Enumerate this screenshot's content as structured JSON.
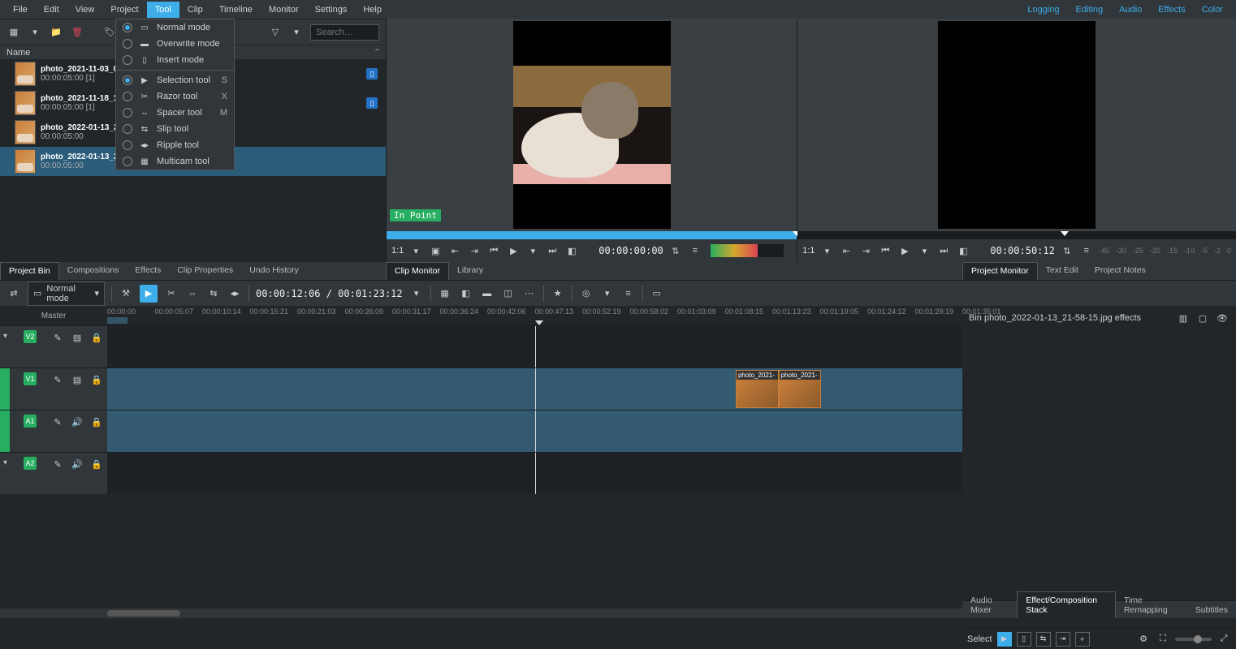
{
  "menubar": {
    "left": [
      "File",
      "Edit",
      "View",
      "Project",
      "Tool",
      "Clip",
      "Timeline",
      "Monitor",
      "Settings",
      "Help"
    ],
    "right": [
      "Logging",
      "Editing",
      "Audio",
      "Effects",
      "Color"
    ],
    "active_index": 4
  },
  "tool_menu": {
    "modes": [
      {
        "label": "Normal mode",
        "checked": true,
        "icon": "▭"
      },
      {
        "label": "Overwrite mode",
        "checked": false,
        "icon": "▬"
      },
      {
        "label": "Insert mode",
        "checked": false,
        "icon": "▯"
      }
    ],
    "tools": [
      {
        "label": "Selection tool",
        "shortcut": "S",
        "checked": true,
        "icon": "▶"
      },
      {
        "label": "Razor tool",
        "shortcut": "X",
        "checked": false,
        "icon": "✂"
      },
      {
        "label": "Spacer tool",
        "shortcut": "M",
        "checked": false,
        "icon": "⇔"
      },
      {
        "label": "Slip tool",
        "shortcut": "",
        "checked": false,
        "icon": "⇆"
      },
      {
        "label": "Ripple tool",
        "shortcut": "",
        "checked": false,
        "icon": "◂▸"
      },
      {
        "label": "Multicam tool",
        "shortcut": "",
        "checked": false,
        "icon": "▦"
      }
    ]
  },
  "bin_toolbar": {
    "search_placeholder": "Search…"
  },
  "bin_header": {
    "name_col": "Name"
  },
  "bin": [
    {
      "name": "photo_2021-11-03_0…",
      "sub": "00:00:05:00 [1]",
      "selected": false,
      "badges": true
    },
    {
      "name": "photo_2021-11-18_1…",
      "sub": "00:00:05:00 [1]",
      "selected": false,
      "badges": true
    },
    {
      "name": "photo_2022-01-13_2…",
      "sub": "00:00:05:00",
      "selected": false,
      "badges": false
    },
    {
      "name": "photo_2022-01-13_2…",
      "sub": "00:00:05:00",
      "selected": true,
      "badges": false
    }
  ],
  "panel_tabs_left": [
    "Project Bin",
    "Compositions",
    "Effects",
    "Clip Properties",
    "Undo History"
  ],
  "clip_monitor": {
    "tabs": [
      "Clip Monitor",
      "Library"
    ],
    "in_point_label": "In Point",
    "zoom": "1:1",
    "timecode": "00:00:00:00",
    "zone_pct": 100,
    "playhead_pct": 100
  },
  "project_monitor": {
    "tabs": [
      "Project Monitor",
      "Text Edit",
      "Project Notes"
    ],
    "zoom": "1:1",
    "timecode": "00:00:50:12",
    "zone_pct": 0,
    "playhead_pct": 60,
    "ticks": [
      "-45",
      "-30",
      "-25",
      "-20",
      "-15",
      "-10",
      "-5",
      "-2",
      "0"
    ]
  },
  "timeline_toolbar": {
    "mode": "Normal mode",
    "timecode": "00:00:12:06 / 00:01:23:12"
  },
  "timeline": {
    "master_label": "Master",
    "ticks": [
      "00:00:00",
      "00:00:05:07",
      "00:00:10:14",
      "00:00:15:21",
      "00:00:21:03",
      "00:00:26:09",
      "00:00:31:17",
      "00:00:36:24",
      "00:00:42:06",
      "00:00:47:13",
      "00:00:52:19",
      "00:00:58:02",
      "00:01:03:09",
      "00:01:08:15",
      "00:01:13:23",
      "00:01:19:05",
      "00:01:24:12",
      "00:01:29:19",
      "00:01:35:01"
    ],
    "playhead_pct": 50,
    "tracks": [
      {
        "label": "V2",
        "type": "video",
        "selected": false
      },
      {
        "label": "V1",
        "type": "video",
        "selected": true
      },
      {
        "label": "A1",
        "type": "audio",
        "selected": true
      },
      {
        "label": "A2",
        "type": "audio",
        "selected": false
      }
    ],
    "clips": [
      {
        "track": 1,
        "left_pct": 73.5,
        "width_pct": 5,
        "label": "photo_2021-"
      },
      {
        "track": 1,
        "left_pct": 78.5,
        "width_pct": 5,
        "label": "photo_2021-"
      }
    ]
  },
  "effect_panel": {
    "title": "Bin photo_2022-01-13_21-58-15.jpg effects"
  },
  "bottom": {
    "right_tabs": [
      "Audio Mixer",
      "Effect/Composition Stack",
      "Time Remapping",
      "Subtitles"
    ],
    "active_right_tab": 1,
    "select_label": "Select"
  }
}
